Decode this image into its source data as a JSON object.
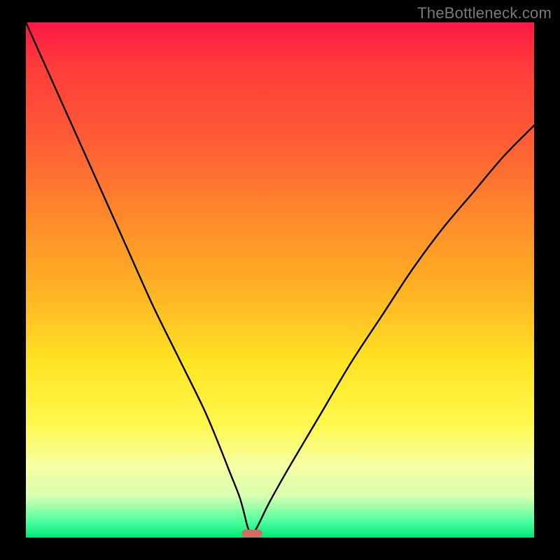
{
  "watermark": "TheBottleneck.com",
  "chart_data": {
    "type": "line",
    "title": "",
    "xlabel": "",
    "ylabel": "",
    "xlim": [
      0,
      100
    ],
    "ylim": [
      0,
      100
    ],
    "x": [
      0,
      5,
      10,
      15,
      20,
      25,
      30,
      35,
      38,
      40,
      42,
      43,
      43.5,
      44,
      44.5,
      45,
      46,
      48,
      52,
      58,
      64,
      70,
      76,
      82,
      88,
      94,
      100
    ],
    "values": [
      100,
      89,
      78,
      67,
      56,
      45,
      35,
      25,
      18,
      13,
      8,
      4.5,
      2.5,
      1.2,
      1.0,
      1.2,
      3,
      7,
      14,
      24,
      34,
      43,
      52,
      60,
      67,
      74,
      80
    ],
    "marker": {
      "x_range": [
        42.5,
        46.5
      ],
      "y": 0.8,
      "color": "#d96a63",
      "shape": "pill"
    },
    "background_gradient": {
      "direction": "top-to-bottom",
      "stops": [
        {
          "pos": 0.0,
          "color": "#ff1744"
        },
        {
          "pos": 0.22,
          "color": "#ff5a36"
        },
        {
          "pos": 0.52,
          "color": "#ffb224"
        },
        {
          "pos": 0.78,
          "color": "#fff84d"
        },
        {
          "pos": 0.92,
          "color": "#d8ffb0"
        },
        {
          "pos": 1.0,
          "color": "#00e676"
        }
      ]
    }
  }
}
